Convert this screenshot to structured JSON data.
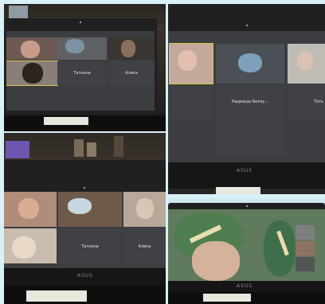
{
  "collage": {
    "panel1": {
      "names": [
        "Татьяна",
        "Алиса"
      ]
    },
    "panel2": {
      "names": [
        "Надежда Белоу...",
        "Тать"
      ],
      "brand": "ASUS"
    },
    "panel3": {
      "names": [
        "Татьяна",
        "Алиса"
      ],
      "brand": "ASUS"
    },
    "panel4": {
      "brand": "ASUS"
    }
  },
  "colors": {
    "background": "#d9f1f8",
    "tile": "#4a4c50",
    "active_speaker_border": "#d3c94a"
  }
}
